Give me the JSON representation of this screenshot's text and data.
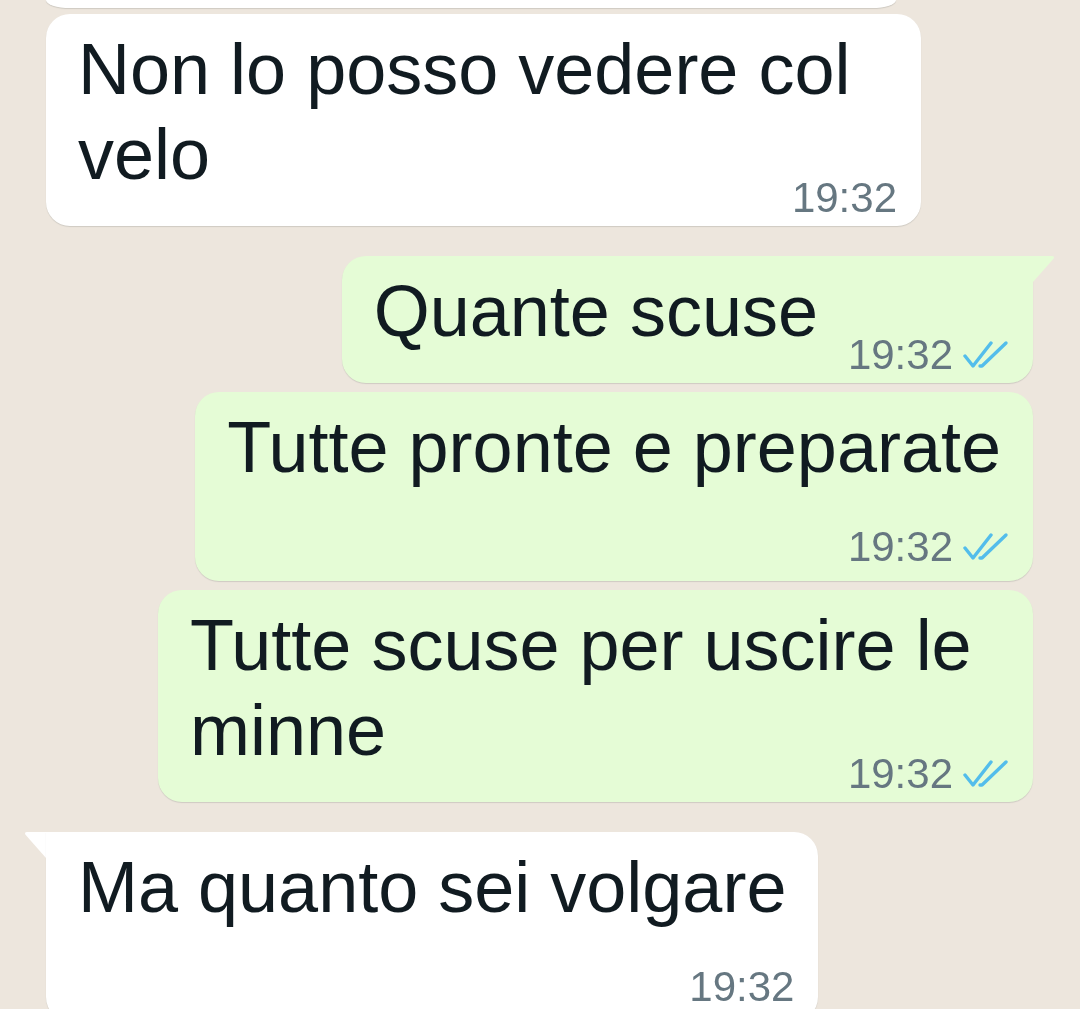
{
  "previous_message_edge": {
    "outgoing": false
  },
  "messages": [
    {
      "outgoing": false,
      "tail": false,
      "text": "Non lo posso vedere col velo",
      "time": "19:32"
    },
    {
      "outgoing": true,
      "tail": true,
      "text": "Quante scuse",
      "time": "19:32",
      "read": true
    },
    {
      "outgoing": true,
      "tail": false,
      "text": "Tutte pronte e preparate",
      "time": "19:32",
      "read": true
    },
    {
      "outgoing": true,
      "tail": false,
      "text": "Tutte scuse per uscire le minne",
      "time": "19:32",
      "read": true
    },
    {
      "outgoing": false,
      "tail": true,
      "text": "Ma quanto sei volgare",
      "time": "19:32"
    }
  ]
}
